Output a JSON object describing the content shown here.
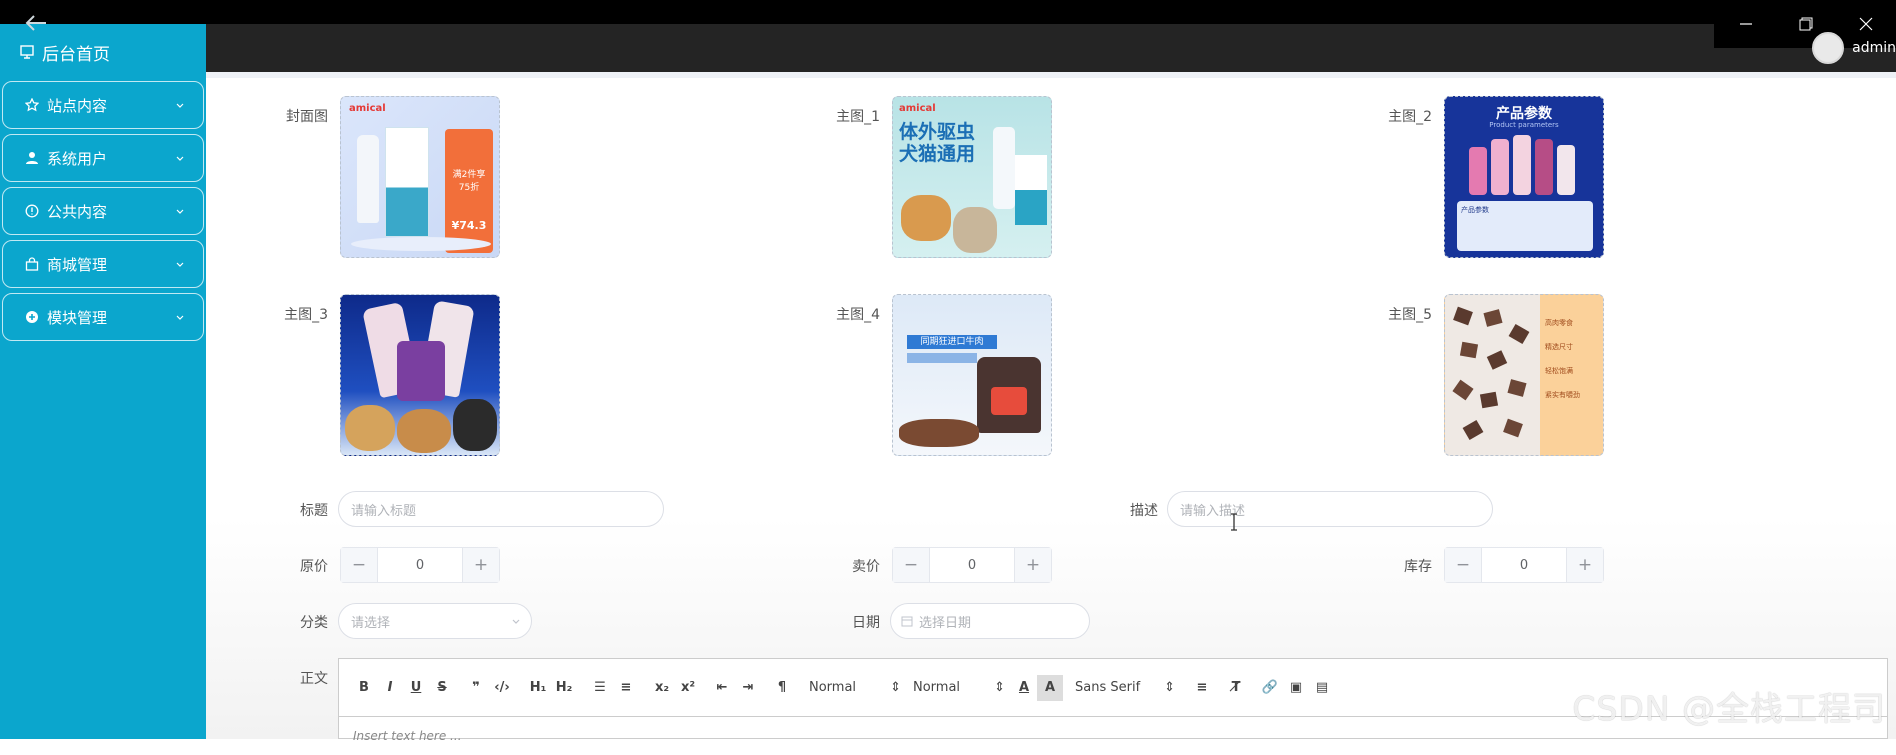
{
  "sidebar": {
    "home": "后台首页",
    "items": [
      {
        "label": "站点内容",
        "icon": "star-icon"
      },
      {
        "label": "系统用户",
        "icon": "user-icon"
      },
      {
        "label": "公共内容",
        "icon": "info-icon"
      },
      {
        "label": "商城管理",
        "icon": "bag-icon"
      },
      {
        "label": "模块管理",
        "icon": "module-icon"
      }
    ]
  },
  "header": {
    "user": "admin"
  },
  "images": [
    {
      "label": "封面图",
      "banner": "amical",
      "text": "满2件享75折",
      "price": "¥74.3"
    },
    {
      "label": "主图_1",
      "banner": "amical",
      "text": "体外驱虫 犬猫通用"
    },
    {
      "label": "主图_2",
      "text": "产品参数",
      "subtext": "Product parameters",
      "sub2": "产品参数"
    },
    {
      "label": "主图_3"
    },
    {
      "label": "主图_4",
      "text": "同期狂进口牛肉"
    },
    {
      "label": "主图_5",
      "lines": [
        "高肉零食",
        "精选尺寸",
        "轻松饱满",
        "紧实有嚼劲"
      ]
    }
  ],
  "form": {
    "title_label": "标题",
    "title_placeholder": "请输入标题",
    "desc_label": "描述",
    "desc_placeholder": "请输入描述",
    "price_label": "原价",
    "price_value": "0",
    "sale_label": "卖价",
    "sale_value": "0",
    "stock_label": "库存",
    "stock_value": "0",
    "category_label": "分类",
    "category_placeholder": "请选择",
    "date_label": "日期",
    "date_placeholder": "选择日期",
    "content_label": "正文"
  },
  "editor": {
    "header_select": "Normal",
    "size_select": "Normal",
    "font_select": "Sans Serif",
    "placeholder": "Insert text here ..."
  },
  "watermark": "CSDN @全栈工程司",
  "colors": {
    "sidebar": "#0ba6cd",
    "header": "#242424",
    "accent": "#409eff"
  }
}
